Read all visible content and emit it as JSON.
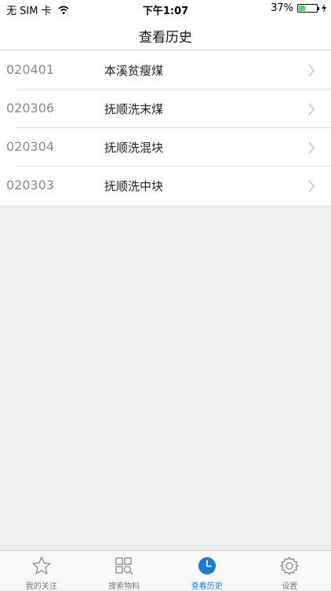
{
  "status": {
    "carrier": "无 SIM 卡",
    "time": "下午1:07",
    "battery": "37%",
    "battery_level": 0.37
  },
  "nav": {
    "title": "查看历史"
  },
  "history": [
    {
      "code": "020401",
      "name": "本溪贫瘦煤"
    },
    {
      "code": "020306",
      "name": "抚顺洗末煤"
    },
    {
      "code": "020304",
      "name": "抚顺洗混块"
    },
    {
      "code": "020303",
      "name": "抚顺洗中块"
    }
  ],
  "tabs": [
    {
      "label": "我的关注",
      "icon": "star-icon"
    },
    {
      "label": "搜索物料",
      "icon": "search-grid-icon"
    },
    {
      "label": "查看历史",
      "icon": "clock-icon",
      "active": true
    },
    {
      "label": "设置",
      "icon": "gear-icon"
    }
  ],
  "colors": {
    "accent": "#1a7ad8",
    "background": "#efefef"
  }
}
